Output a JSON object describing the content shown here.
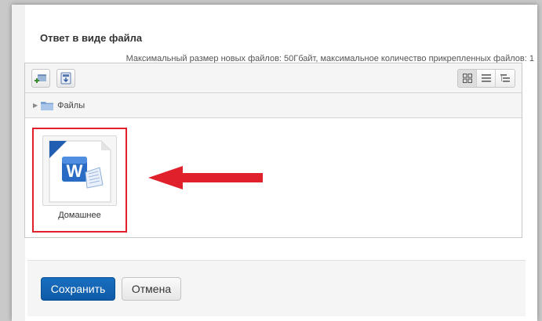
{
  "section": {
    "title": "Ответ в виде файла",
    "max_size_note": "Максимальный размер новых файлов: 50Гбайт, максимальное количество прикрепленных файлов: 1"
  },
  "filemanager": {
    "toolbar": {
      "add_icon": "add-file-icon",
      "download_icon": "download-icon",
      "views": [
        "icons-view-icon",
        "list-view-icon",
        "tree-view-icon"
      ],
      "active_view": "icons-view-icon"
    },
    "path": {
      "folder_label": "Файлы"
    },
    "files": [
      {
        "name": "Домашнее",
        "icon": "word-document-icon"
      }
    ]
  },
  "annotation": {
    "arrow_color": "#e0202b",
    "highlight_color": "#e0202b"
  },
  "footer": {
    "save_label": "Сохранить",
    "cancel_label": "Отмена"
  },
  "colors": {
    "primary": "#0d5aa7",
    "word_blue": "#1f5eb0"
  }
}
